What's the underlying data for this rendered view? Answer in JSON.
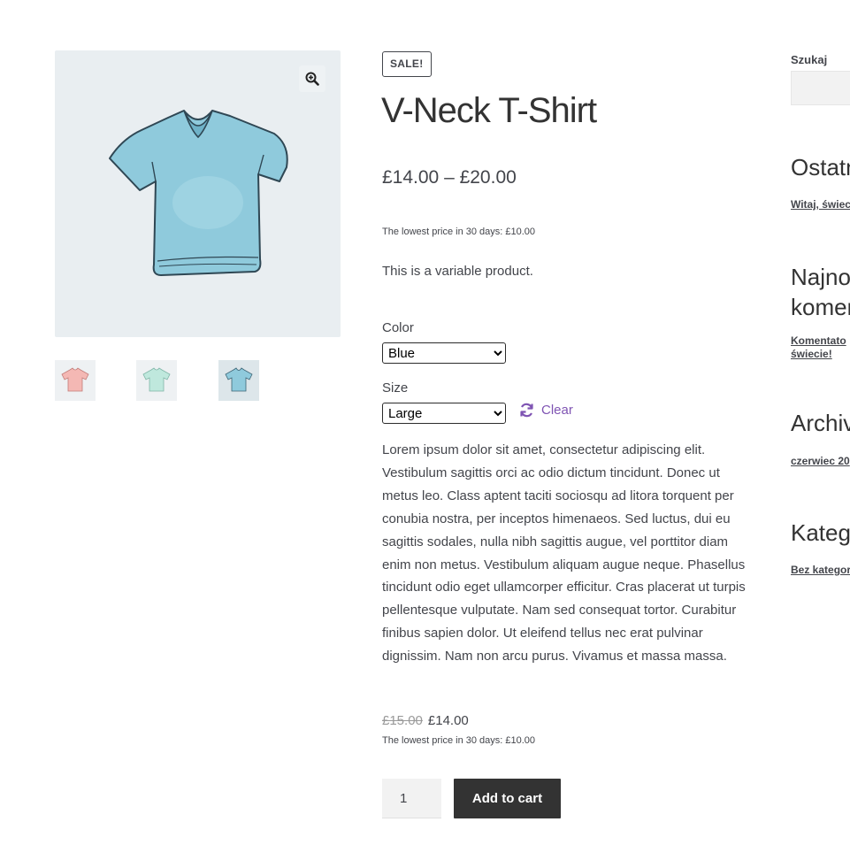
{
  "gallery": {
    "zoom_icon": "magnifier-plus-icon",
    "main_image": "tshirt-blue",
    "thumbnails": [
      "tshirt-pink",
      "tshirt-mint",
      "tshirt-blue"
    ]
  },
  "product": {
    "sale_badge": "SALE!",
    "title": "V-Neck T-Shirt",
    "price_range": "£14.00 – £20.00",
    "lowest_price_note": "The lowest price in 30 days: £10.00",
    "short_description": "This is a variable product.",
    "variations": {
      "color_label": "Color",
      "color_value": "Blue",
      "size_label": "Size",
      "size_value": "Large",
      "clear_label": "Clear"
    },
    "description": "Lorem ipsum dolor sit amet, consectetur adipiscing elit. Vestibulum sagittis orci ac odio dictum tincidunt. Donec ut metus leo. Class aptent taciti sociosqu ad litora torquent per conubia nostra, per inceptos himenaeos. Sed luctus, dui eu sagittis sodales, nulla nibh sagittis augue, vel porttitor diam enim non metus. Vestibulum aliquam augue neque. Phasellus tincidunt odio eget ullamcorper efficitur. Cras placerat ut turpis pellentesque vulputate. Nam sed consequat tortor. Curabitur finibus sapien dolor. Ut eleifend tellus nec erat pulvinar dignissim. Nam non arcu purus. Vivamus et massa massa.",
    "variation_price_old": "£15.00",
    "variation_price_new": "£14.00",
    "variation_lowest_note": "The lowest price in 30 days: £10.00",
    "quantity": "1",
    "add_to_cart_label": "Add to cart"
  },
  "sidebar": {
    "search_label": "Szukaj",
    "recent_posts_heading": "Ostatn",
    "recent_post_link": "Witaj, świec",
    "recent_comments_heading_1": "Najno",
    "recent_comments_heading_2": "komer",
    "recent_comment_line_1": "Komentato",
    "recent_comment_line_2": "świecie!",
    "archives_heading": "Archiv",
    "archive_link": "czerwiec 20",
    "categories_heading": "Kategc",
    "category_link": "Bez kategor"
  },
  "colors": {
    "accent": "#7f54b3",
    "button_bg": "#333333",
    "text": "#43454b",
    "image_bg": "#e9eef1",
    "tshirt_blue": "#8fcadc",
    "tshirt_pink": "#f4b8b4",
    "tshirt_mint": "#bfe8dd"
  }
}
